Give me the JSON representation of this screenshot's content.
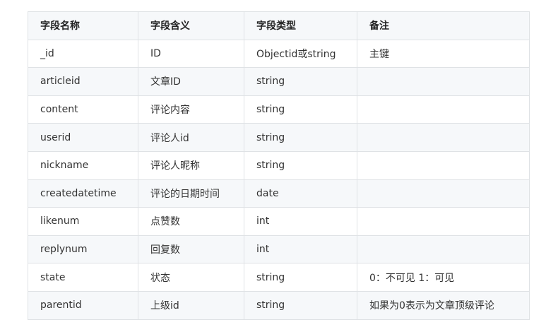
{
  "table": {
    "headers": [
      "字段名称",
      "字段含义",
      "字段类型",
      "备注"
    ],
    "rows": [
      [
        "_id",
        "ID",
        "Objectid或string",
        "主键"
      ],
      [
        "articleid",
        "文章ID",
        "string",
        ""
      ],
      [
        "content",
        "评论内容",
        "string",
        ""
      ],
      [
        "userid",
        "评论人id",
        "string",
        ""
      ],
      [
        "nickname",
        "评论人昵称",
        "string",
        ""
      ],
      [
        "createdatetime",
        "评论的日期时间",
        "date",
        ""
      ],
      [
        "likenum",
        "点赞数",
        "int",
        ""
      ],
      [
        "replynum",
        "回复数",
        "int",
        ""
      ],
      [
        "state",
        "状态",
        "string",
        "0：不可见 1：可见"
      ],
      [
        "parentid",
        "上级id",
        "string",
        "如果为0表示为文章顶级评论"
      ]
    ]
  }
}
